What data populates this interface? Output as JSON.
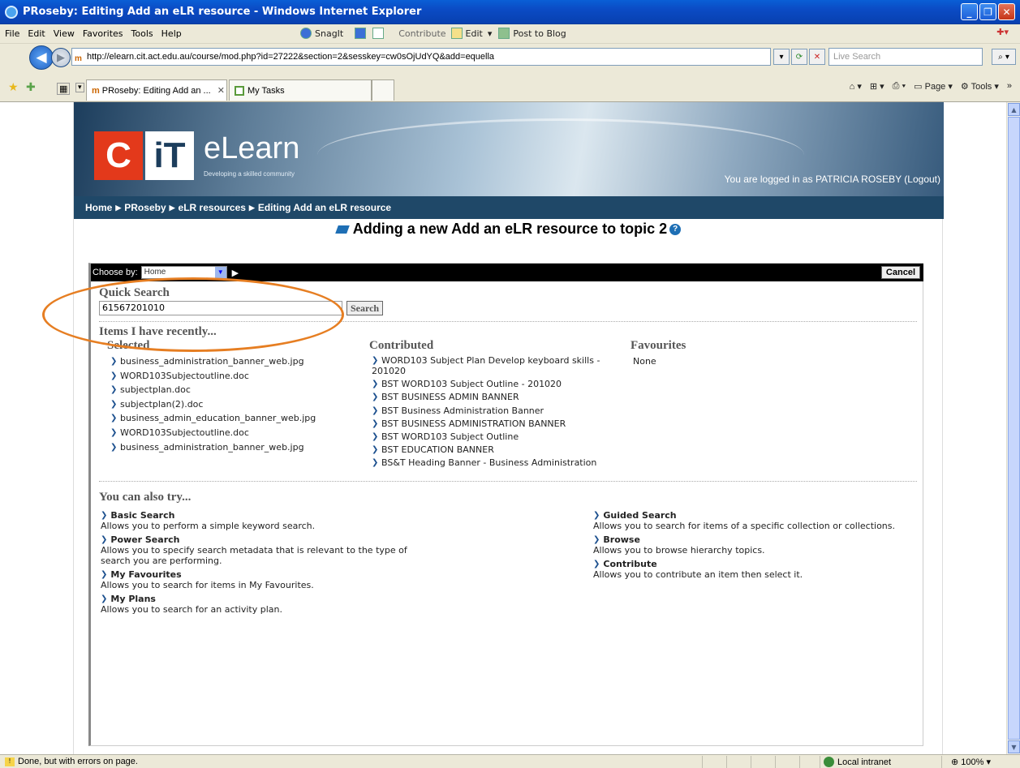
{
  "window": {
    "title": "PRoseby: Editing Add an eLR resource - Windows Internet Explorer"
  },
  "menu": [
    "File",
    "Edit",
    "View",
    "Favorites",
    "Tools",
    "Help"
  ],
  "toolbar": {
    "snagit": "SnagIt",
    "contribute": "Contribute",
    "edit": "Edit",
    "post": "Post to Blog"
  },
  "address": {
    "url": "http://elearn.cit.act.edu.au/course/mod.php?id=27222&section=2&sesskey=cw0sOjUdYQ&add=equella",
    "search_placeholder": "Live Search"
  },
  "tabs": [
    {
      "label": "PRoseby: Editing Add an ...",
      "active": true
    },
    {
      "label": "My Tasks",
      "active": false
    }
  ],
  "command_bar": {
    "page": "Page",
    "tools": "Tools"
  },
  "site": {
    "logo_c": "C",
    "logo_t": "iT",
    "name": "eLearn",
    "tagline": "Developing a skilled community",
    "logged_in": "You are logged in as PATRICIA ROSEBY (Logout)",
    "breadcrumb": [
      "Home",
      "PRoseby",
      "eLR resources",
      "Editing Add an eLR resource"
    ],
    "page_heading": "Adding a new Add an eLR resource to topic 2"
  },
  "equella": {
    "choose_by_label": "Choose by:",
    "choose_by_value": "Home",
    "cancel": "Cancel",
    "quick_search_title": "Quick Search",
    "quick_search_value": "61567201010",
    "search_button": "Search",
    "recent_title": "Items I have recently...",
    "selected_title": "Selected",
    "selected": [
      "business_administration_banner_web.jpg",
      "WORD103Subjectoutline.doc",
      "subjectplan.doc",
      "subjectplan(2).doc",
      "business_admin_education_banner_web.jpg",
      "WORD103Subjectoutline.doc",
      "business_administration_banner_web.jpg"
    ],
    "contributed_title": "Contributed",
    "contributed": [
      "WORD103 Subject Plan Develop keyboard skills -",
      "BST WORD103 Subject Outline - 201020",
      "BST BUSINESS ADMIN BANNER",
      "BST Business Administration Banner",
      "BST BUSINESS ADMINISTRATION BANNER",
      "BST WORD103 Subject Outline",
      "BST EDUCATION BANNER",
      "BS&T Heading Banner - Business Administration"
    ],
    "contributed_wrap": "201020",
    "favourites_title": "Favourites",
    "favourites_value": "None",
    "try_title": "You can also try...",
    "try_left": [
      {
        "title": "Basic Search",
        "desc": "Allows you to perform a simple keyword search."
      },
      {
        "title": "Power Search",
        "desc": "Allows you to specify search metadata that is relevant to the type of search you are performing."
      },
      {
        "title": "My Favourites",
        "desc": "Allows you to search for items in My Favourites."
      },
      {
        "title": "My Plans",
        "desc": "Allows you to search for an activity plan."
      }
    ],
    "try_right": [
      {
        "title": "Guided Search",
        "desc": "Allows you to search for items of a specific collection or collections."
      },
      {
        "title": "Browse",
        "desc": "Allows you to browse hierarchy topics."
      },
      {
        "title": "Contribute",
        "desc": "Allows you to contribute an item then select it."
      }
    ]
  },
  "status": {
    "text": "Done, but with errors on page.",
    "zone": "Local intranet",
    "zoom": "100%"
  },
  "colors": {
    "highlight_oval": "#e67e22",
    "breadcrumb_bg": "#1f4868",
    "accent": "#1b4f8e"
  }
}
